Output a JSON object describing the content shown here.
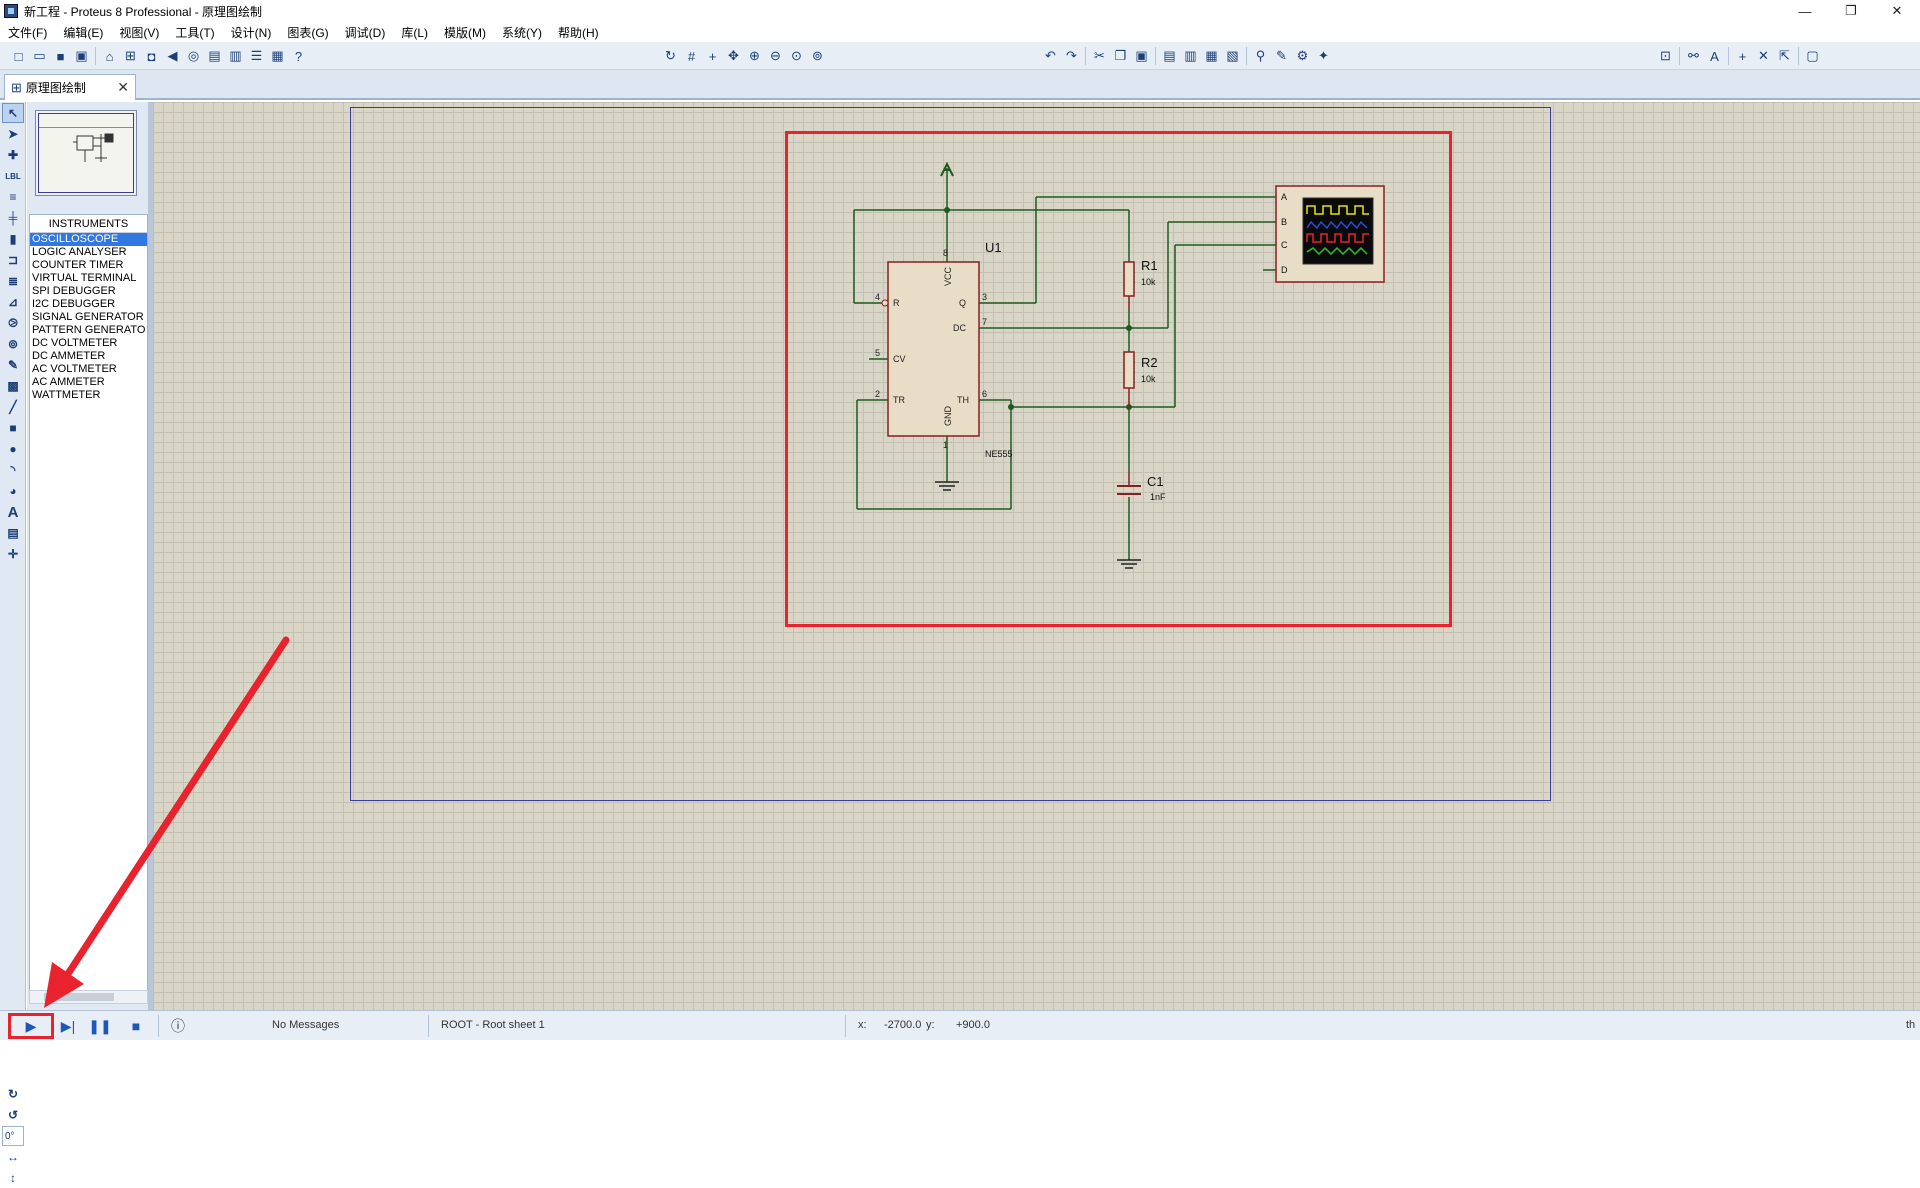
{
  "window": {
    "title": "新工程 - Proteus 8 Professional - 原理图绘制",
    "controls": [
      "—",
      "❐",
      "✕"
    ]
  },
  "menu": [
    "文件(F)",
    "编辑(E)",
    "视图(V)",
    "工具(T)",
    "设计(N)",
    "图表(G)",
    "调试(D)",
    "库(L)",
    "模版(M)",
    "系统(Y)",
    "帮助(H)"
  ],
  "tab": {
    "label": "原理图绘制",
    "close": "✕"
  },
  "devices": {
    "header": "INSTRUMENTS",
    "items": [
      "OSCILLOSCOPE",
      "LOGIC ANALYSER",
      "COUNTER TIMER",
      "VIRTUAL TERMINAL",
      "SPI DEBUGGER",
      "I2C DEBUGGER",
      "SIGNAL GENERATOR",
      "PATTERN GENERATO",
      "DC VOLTMETER",
      "DC AMMETER",
      "AC VOLTMETER",
      "AC AMMETER",
      "WATTMETER"
    ],
    "selected": "OSCILLOSCOPE"
  },
  "rotation": "0°",
  "schematic": {
    "u1_ref": "U1",
    "u1_part": "NE555",
    "pins": {
      "r": "R",
      "vcc": "VCC",
      "q": "Q",
      "dc": "DC",
      "cv": "CV",
      "tr": "TR",
      "gnd": "GND",
      "th": "TH"
    },
    "pin_numbers": {
      "p8": "8",
      "p4": "4",
      "p3": "3",
      "p7": "7",
      "p5": "5",
      "p2": "2",
      "p6": "6",
      "p1": "1"
    },
    "r1_ref": "R1",
    "r1_val": "10k",
    "r2_ref": "R2",
    "r2_val": "10k",
    "c1_ref": "C1",
    "c1_val": "1nF",
    "scope_channels": [
      "A",
      "B",
      "C",
      "D"
    ],
    "trace_colors": [
      "#e6e600",
      "#2a4ad8",
      "#e8232d",
      "#2cbf2c"
    ]
  },
  "status": {
    "messages": "No Messages",
    "sheet": "ROOT - Root sheet 1",
    "x_label": "x:",
    "x_value": "-2700.0",
    "y_label": "y:",
    "y_value": "+900.0",
    "units": "th"
  }
}
